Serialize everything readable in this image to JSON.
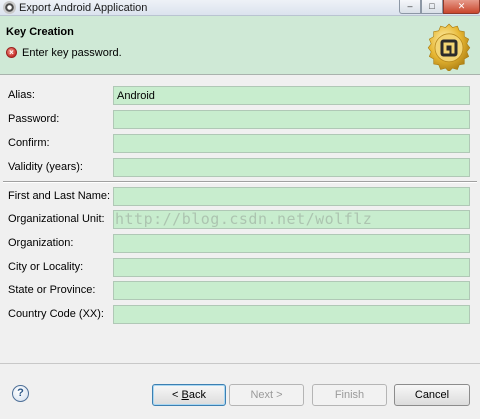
{
  "window": {
    "title": "Export Android Application",
    "min_symbol": "–",
    "max_symbol": "□",
    "close_symbol": "✕"
  },
  "banner": {
    "title": "Key Creation",
    "message": "Enter key password.",
    "error_symbol": "×",
    "badge_icon": "android-adt-seal-icon"
  },
  "form": {
    "alias": {
      "label": "Alias:",
      "value": "Android"
    },
    "password": {
      "label": "Password:",
      "value": ""
    },
    "confirm": {
      "label": "Confirm:",
      "value": ""
    },
    "validity": {
      "label": "Validity (years):",
      "value": ""
    },
    "first_last_name": {
      "label": "First and Last Name:",
      "value": ""
    },
    "org_unit": {
      "label": "Organizational Unit:",
      "value": ""
    },
    "organization": {
      "label": "Organization:",
      "value": ""
    },
    "city": {
      "label": "City or Locality:",
      "value": ""
    },
    "state": {
      "label": "State or Province:",
      "value": ""
    },
    "country": {
      "label": "Country Code (XX):",
      "value": ""
    }
  },
  "watermark": "http://blog.csdn.net/wolflz",
  "footer": {
    "help_symbol": "?",
    "back_prefix": "< ",
    "back_mnemonic": "B",
    "back_rest": "ack",
    "next_label": "Next >",
    "finish_label": "Finish",
    "cancel_label": "Cancel"
  },
  "colors": {
    "banner_bg": "#cfe9d6",
    "field_bg": "#c8edce",
    "dialog_bg": "#f0f0f0",
    "error_red": "#c9302c",
    "badge_gold": "#e7b733"
  }
}
